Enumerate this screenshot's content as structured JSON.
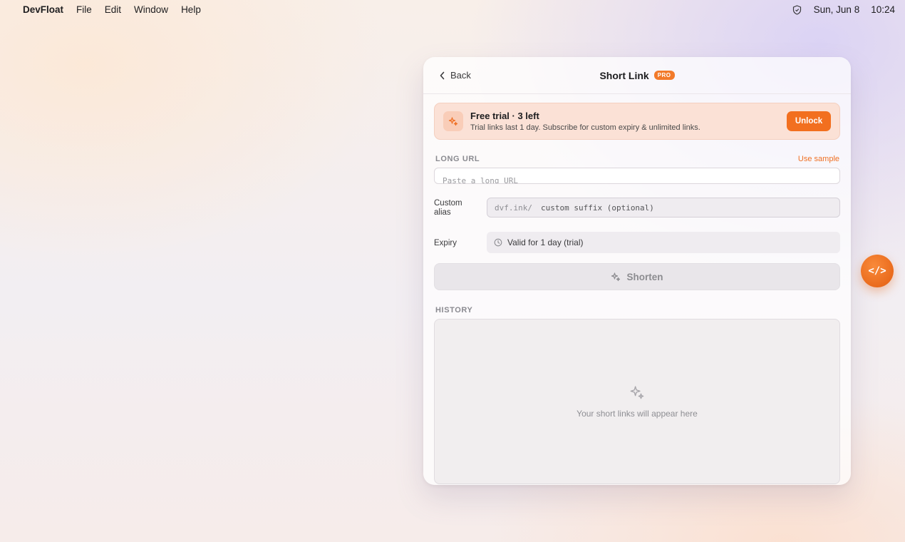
{
  "menubar": {
    "app_name": "DevFloat",
    "menus": [
      "File",
      "Edit",
      "Window",
      "Help"
    ],
    "date": "Sun, Jun 8",
    "time": "10:24"
  },
  "panel": {
    "back_label": "Back",
    "title": "Short Link",
    "badge": "PRO",
    "trial": {
      "title": "Free trial · 3 left",
      "subtitle": "Trial links last 1 day. Subscribe for custom expiry & unlimited links.",
      "unlock_label": "Unlock"
    },
    "long_url": {
      "label": "LONG URL",
      "use_sample": "Use sample",
      "placeholder": "Paste a long URL"
    },
    "alias": {
      "label": "Custom alias",
      "prefix": "dvf.ink/",
      "placeholder": "custom suffix (optional)"
    },
    "expiry": {
      "label": "Expiry",
      "value": "Valid for 1 day (trial)"
    },
    "shorten_label": "Shorten",
    "history": {
      "label": "HISTORY",
      "empty_text": "Your short links will appear here"
    }
  },
  "fab": {
    "label": "</>"
  },
  "colors": {
    "accent": "#f26f1f",
    "badge": "#f27a2a",
    "trial_bg": "#fbe1d6"
  }
}
